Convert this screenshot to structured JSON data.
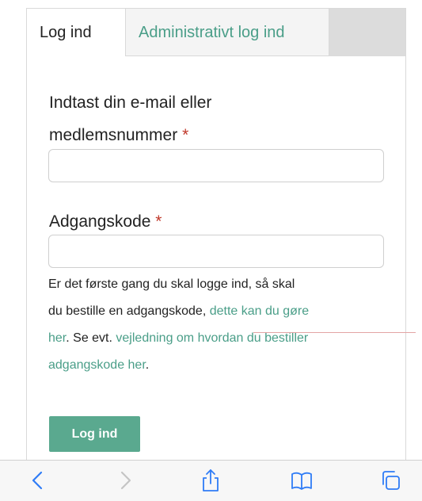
{
  "tabs": {
    "login": "Log ind",
    "admin": "Administrativt log ind"
  },
  "form": {
    "email_label_line1": "Indtast din e-mail eller",
    "email_label_line2": "medlemsnummer",
    "password_label": "Adgangskode",
    "required_marker": "*",
    "email_value": "",
    "password_value": ""
  },
  "help": {
    "line1": "Er det første gang du skal logge ind, så skal",
    "line2_text": "du bestille en adgangskode,",
    "line2_link": "dette kan du gøre",
    "line3_link": "her",
    "line3_text": ". Se evt.",
    "line3_link2": "vejledning om hvordan du bestiller",
    "line4_link": "adgangskode her",
    "line4_text": "."
  },
  "button": {
    "login": "Log ind"
  },
  "toolbar": {
    "icons": [
      "back-icon",
      "forward-icon",
      "share-icon",
      "bookmarks-icon",
      "tabs-icon"
    ],
    "accent_color": "#2f7cf6",
    "disabled_color": "#c5c5c5"
  },
  "colors": {
    "link": "#4a9e88",
    "button": "#5aa98f",
    "required": "#c0392b"
  }
}
